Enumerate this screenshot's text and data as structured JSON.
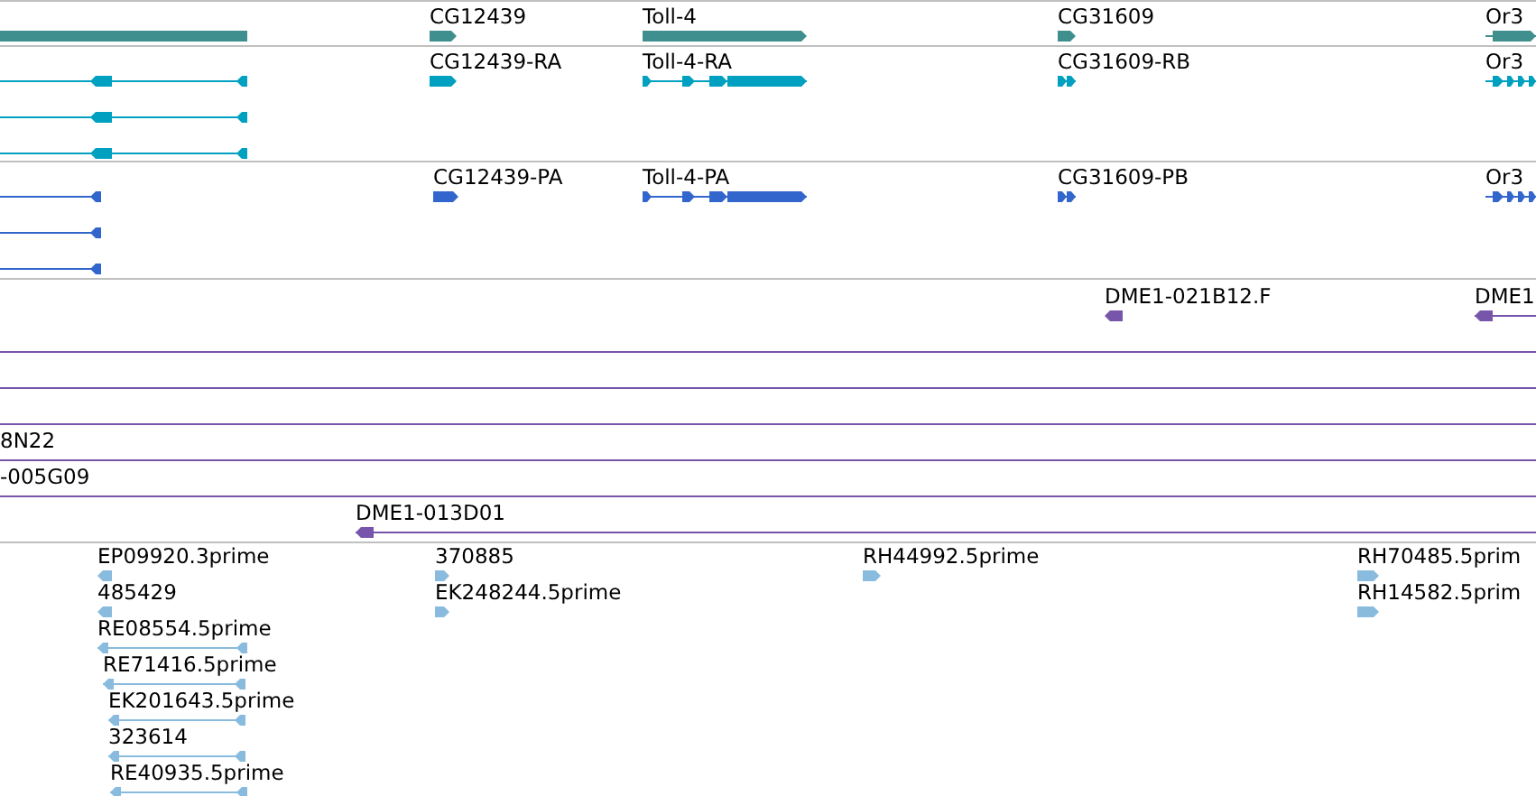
{
  "tracks": [
    {
      "kind": "gene",
      "features": [
        {
          "kind": "bar"
        },
        {
          "kind": "arrow",
          "label": "CG12439",
          "reverse": false
        },
        {
          "kind": "arrow",
          "label": "Toll-4",
          "reverse": false
        },
        {
          "kind": "arrow",
          "label": "CG31609",
          "reverse": false
        },
        {
          "kind": "arrow",
          "label": "Or3",
          "reverse": false
        }
      ]
    },
    {
      "kind": "transcript",
      "features": [
        {
          "kind": "arrow",
          "reverse": true
        },
        {
          "kind": "arrow",
          "reverse": true
        },
        {
          "kind": "arrow",
          "reverse": true
        },
        {
          "kind": "arrow",
          "label": "CG12439-RA",
          "reverse": false
        },
        {
          "kind": "arrow",
          "label": "Toll-4-RA",
          "reverse": false
        },
        {
          "kind": "arrow",
          "label": "CG31609-RB",
          "reverse": false
        },
        {
          "kind": "arrow",
          "label": "Or3",
          "reverse": false
        }
      ]
    },
    {
      "kind": "protein",
      "features": [
        {
          "kind": "arrow",
          "reverse": true
        },
        {
          "kind": "arrow",
          "reverse": true
        },
        {
          "kind": "arrow",
          "reverse": true
        },
        {
          "kind": "arrow",
          "label": "CG12439-PA",
          "reverse": false
        },
        {
          "kind": "arrow",
          "label": "Toll-4-PA",
          "reverse": false
        },
        {
          "kind": "arrow",
          "label": "CG31609-PB",
          "reverse": false
        },
        {
          "kind": "arrow",
          "label": "Or3",
          "reverse": false
        }
      ]
    },
    {
      "kind": "clone",
      "features": [
        {
          "kind": "arrow",
          "label": "DME1-021B12.F",
          "reverse": true
        },
        {
          "kind": "arrow",
          "label": "DME1",
          "reverse": true
        },
        {
          "kind": "line"
        },
        {
          "kind": "line"
        },
        {
          "kind": "line"
        },
        {
          "kind": "line",
          "label": "8N22"
        },
        {
          "kind": "line",
          "label": "-005G09"
        },
        {
          "kind": "arrow",
          "label": "DME1-013D01",
          "reverse": true
        }
      ]
    },
    {
      "kind": "est",
      "features": [
        {
          "kind": "arrow",
          "label": "EP09920.3prime",
          "reverse": true
        },
        {
          "kind": "arrow",
          "label": "485429",
          "reverse": true
        },
        {
          "kind": "arrow",
          "label": "RE08554.5prime",
          "reverse": true
        },
        {
          "kind": "arrow",
          "label": "RE71416.5prime",
          "reverse": true
        },
        {
          "kind": "arrow",
          "label": "EK201643.5prime",
          "reverse": true
        },
        {
          "kind": "arrow",
          "label": "323614",
          "reverse": true
        },
        {
          "kind": "arrow",
          "label": "RE40935.5prime",
          "reverse": true
        },
        {
          "kind": "arrow",
          "label": "370885",
          "reverse": false
        },
        {
          "kind": "arrow",
          "label": "EK248244.5prime",
          "reverse": false
        },
        {
          "kind": "arrow",
          "label": "RH44992.5prime",
          "reverse": false
        },
        {
          "kind": "arrow",
          "label": "RH70485.5prim",
          "reverse": false
        },
        {
          "kind": "arrow",
          "label": "RH14582.5prim",
          "reverse": false
        }
      ]
    }
  ]
}
